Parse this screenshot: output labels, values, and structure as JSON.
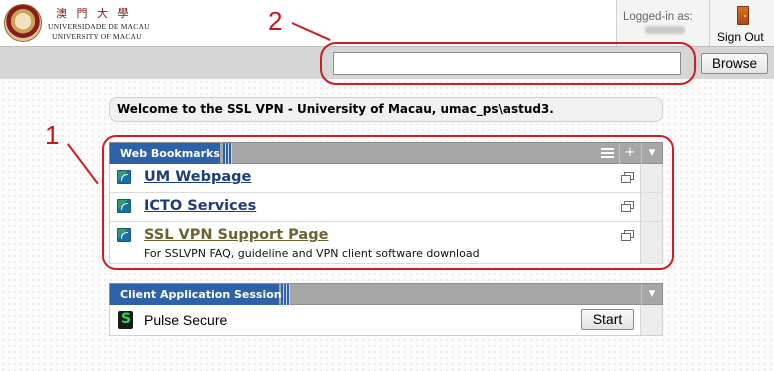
{
  "header": {
    "logo_chinese": "澳 門 大 學",
    "logo_portuguese": "UNIVERSIDADE DE MACAU",
    "logo_english": "UNIVERSITY OF MACAU",
    "logged_in_label": "Logged-in as:",
    "signout_label": "Sign Out",
    "signout_icon": "door-icon"
  },
  "toolbar": {
    "browse_value": "",
    "browse_label": "Browse"
  },
  "welcome": "Welcome to the SSL VPN - University of Macau, umac_ps\\astud3.",
  "bookmarks": {
    "title": "Web Bookmarks",
    "items": [
      {
        "label": "UM Webpage",
        "description": ""
      },
      {
        "label": "ICTO Services",
        "description": ""
      },
      {
        "label": "SSL VPN Support Page",
        "description": "For SSLVPN FAQ, guideline and VPN client software download"
      }
    ]
  },
  "client_apps": {
    "title": "Client Application Sessions",
    "items": [
      {
        "name": "Pulse Secure",
        "action_label": "Start"
      }
    ]
  },
  "annotations": [
    "1",
    "2"
  ],
  "colors": {
    "tab_blue": "#2e62a8",
    "link_blue": "#1d3c7a",
    "annotation_red": "#d11b22"
  }
}
